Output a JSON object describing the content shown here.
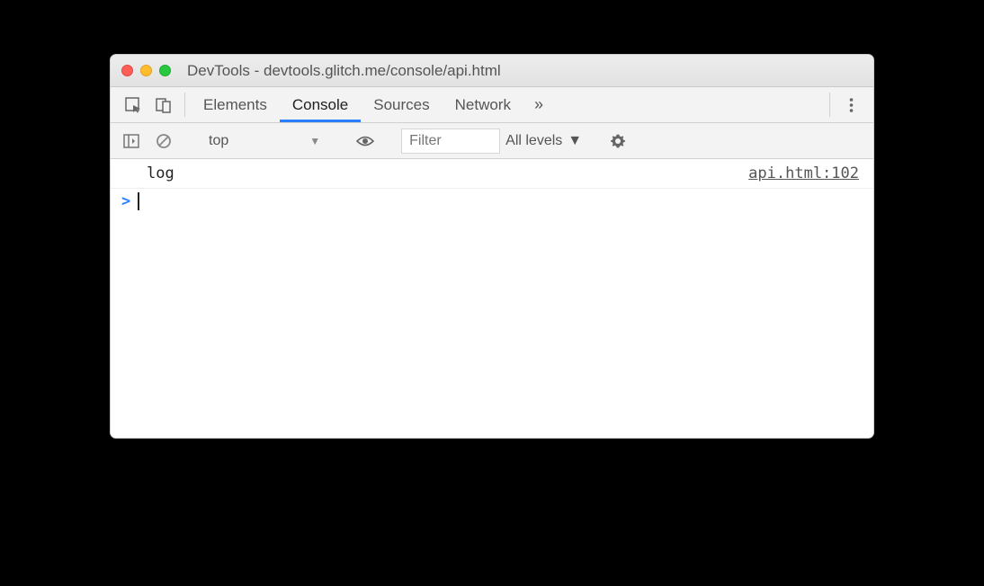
{
  "window": {
    "title": "DevTools - devtools.glitch.me/console/api.html"
  },
  "tabs": {
    "elements": "Elements",
    "console": "Console",
    "sources": "Sources",
    "network": "Network",
    "more": "»"
  },
  "toolbar": {
    "context": "top",
    "filter_placeholder": "Filter",
    "levels": "All levels"
  },
  "console": {
    "log_message": "log",
    "log_source": "api.html:102",
    "prompt": ">"
  }
}
